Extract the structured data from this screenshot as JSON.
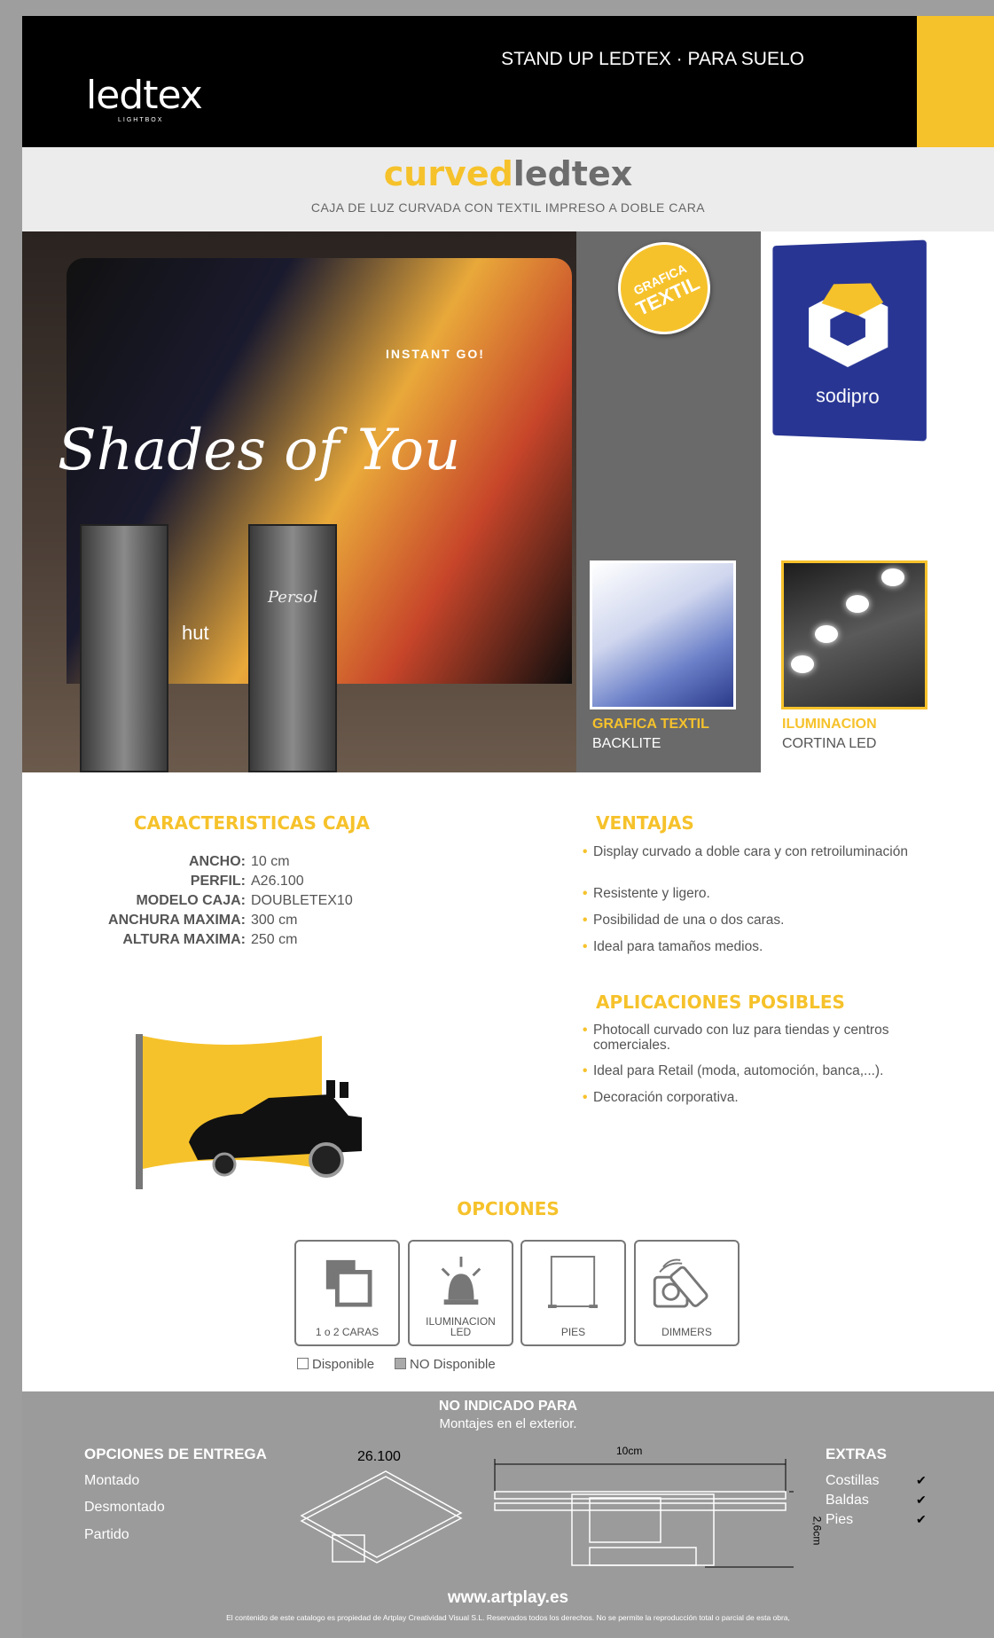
{
  "header": {
    "brand": "ledtex",
    "brand_sub": "LIGHTBOX",
    "tagline": "STAND UP LEDTEX · PARA SUELO",
    "accent_color": "#f6c22b"
  },
  "product": {
    "title_part1": "curved",
    "title_part2": "ledtex",
    "subtitle": "CAJA DE LUZ CURVADA CON TEXTIL IMPRESO A DOBLE CARA"
  },
  "hero": {
    "banner_text": "Shades of You",
    "banner_text2": "INSTANT GO!",
    "stand_text": "hut",
    "stand_text2": "Persol"
  },
  "badge": {
    "line1": "GRAFICA",
    "line2": "TEXTIL"
  },
  "sodipro": {
    "label": "sodipro"
  },
  "thumbs": [
    {
      "title": "GRAFICA TEXTIL",
      "sub": "BACKLITE"
    },
    {
      "title": "ILUMINACION",
      "sub": "CORTINA LED"
    }
  ],
  "caracteristicas": {
    "heading": "CARACTERISTICAS CAJA",
    "rows": [
      {
        "k": "ANCHO:",
        "v": "10 cm"
      },
      {
        "k": "PERFIL:",
        "v": "A26.100"
      },
      {
        "k": "MODELO CAJA:",
        "v": "DOUBLETEX10"
      },
      {
        "k": "ANCHURA MAXIMA:",
        "v": "300 cm"
      },
      {
        "k": "ALTURA MAXIMA:",
        "v": "250 cm"
      }
    ]
  },
  "ventajas": {
    "heading": "VENTAJAS",
    "items": [
      "Display curvado a doble cara y con retroiluminación",
      "Resistente y ligero.",
      "Posibilidad de una o dos caras.",
      "Ideal para tamaños medios."
    ]
  },
  "aplicaciones": {
    "heading": "APLICACIONES POSIBLES",
    "items": [
      "Photocall curvado con luz para tiendas y centros  comerciales.",
      "Ideal para Retail (moda, automoción, banca,...).",
      "Decoración corporativa."
    ]
  },
  "opciones": {
    "heading": "OPCIONES",
    "items": [
      {
        "label": "1 o 2 CARAS",
        "icon": "layers-icon"
      },
      {
        "label": "ILUMINACION LED",
        "icon": "beacon-icon"
      },
      {
        "label": "PIES",
        "icon": "stand-icon"
      },
      {
        "label": "DIMMERS",
        "icon": "remote-icon"
      }
    ],
    "legend_available": "Disponible",
    "legend_unavailable": "NO Disponible"
  },
  "footer": {
    "not_for": "NO INDICADO PARA",
    "not_for_sub": "Montajes en el exterior.",
    "entrega_heading": "OPCIONES DE ENTREGA",
    "entrega": [
      "Montado",
      "Desmontado",
      "Partido"
    ],
    "profile_code": "26.100",
    "dim_width": "10cm",
    "dim_height": "2,6cm",
    "extras_heading": "EXTRAS",
    "extras": [
      "Costillas",
      "Baldas",
      "Pies"
    ],
    "check": "✔",
    "website": "www.artplay.es",
    "legal": "El contenido de este catalogo es propiedad de Artplay Creatividad Visual S.L. Reservados todos los derechos. No se permite la reproducción total o parcial de esta obra,"
  }
}
